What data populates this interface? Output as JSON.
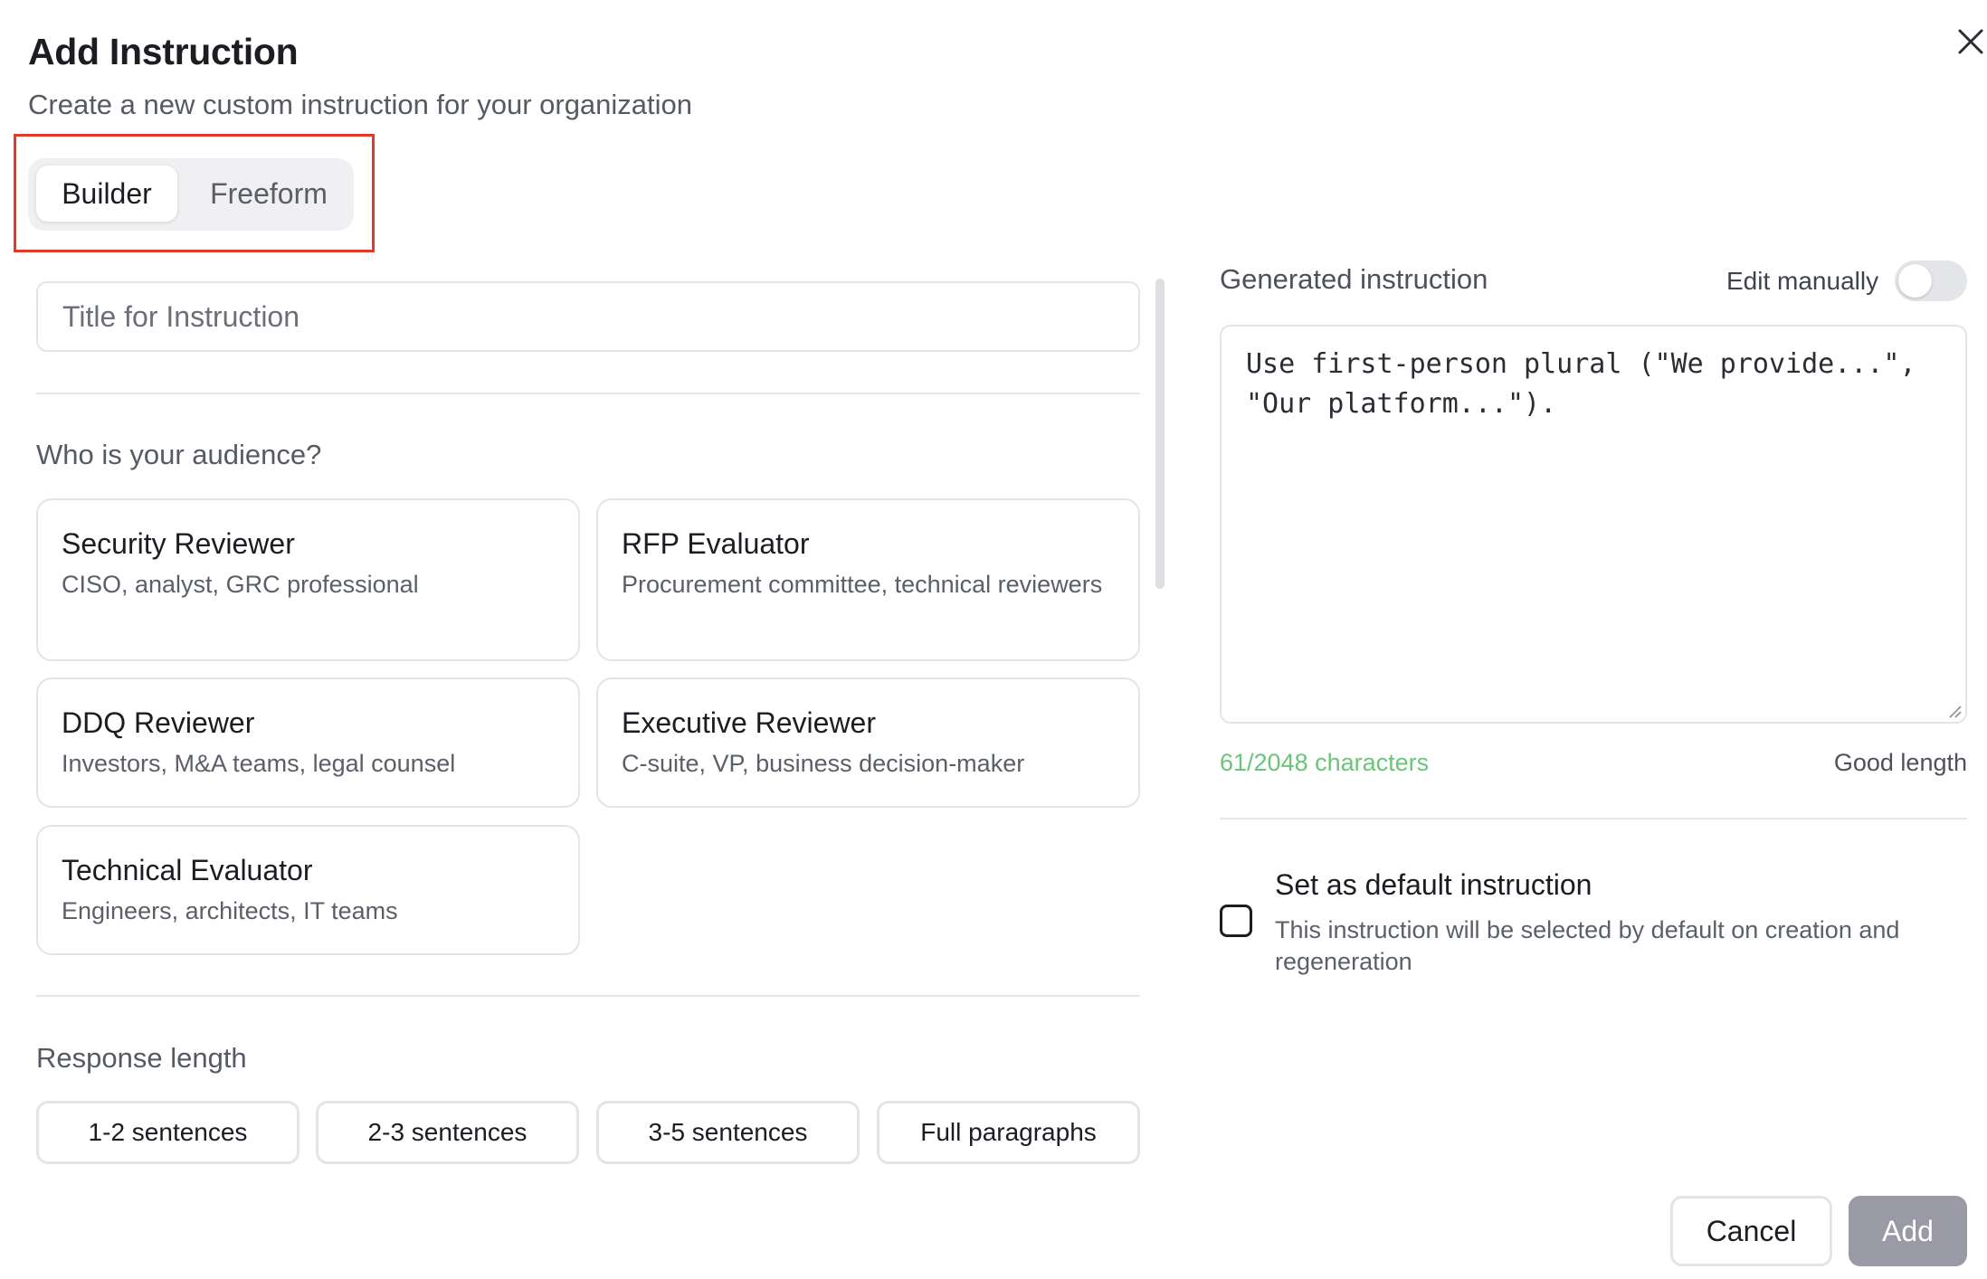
{
  "dialog": {
    "title": "Add Instruction",
    "subtitle": "Create a new custom instruction for your organization"
  },
  "mode_tabs": [
    {
      "label": "Builder",
      "active": true
    },
    {
      "label": "Freeform",
      "active": false
    }
  ],
  "builder": {
    "title_placeholder": "Title for Instruction",
    "audience_heading": "Who is your audience?",
    "audiences": [
      {
        "title": "Security Reviewer",
        "desc": "CISO, analyst, GRC professional"
      },
      {
        "title": "RFP Evaluator",
        "desc": "Procurement committee, technical reviewers"
      },
      {
        "title": "DDQ Reviewer",
        "desc": "Investors, M&A teams, legal counsel"
      },
      {
        "title": "Executive Reviewer",
        "desc": "C-suite, VP, business decision-maker"
      },
      {
        "title": "Technical Evaluator",
        "desc": "Engineers, architects, IT teams"
      }
    ],
    "length_heading": "Response length",
    "length_options": [
      "1-2 sentences",
      "2-3 sentences",
      "3-5 sentences",
      "Full paragraphs"
    ]
  },
  "generated": {
    "label": "Generated instruction",
    "edit_manually_label": "Edit manually",
    "edit_manually_on": false,
    "text": "Use first-person plural (\"We provide...\",\n\"Our platform...\").",
    "char_count": "61/2048 characters",
    "length_status": "Good length"
  },
  "default_option": {
    "title": "Set as default instruction",
    "desc": "This instruction will be selected by default on creation and regeneration",
    "checked": false
  },
  "footer": {
    "cancel_label": "Cancel",
    "add_label": "Add"
  },
  "icons": {
    "close": "close-icon",
    "resize": "resize-grip-icon"
  },
  "colors": {
    "highlight": "#e03b2a",
    "char_count_ok": "#6cc37a",
    "add_disabled": "#9a99a6"
  }
}
